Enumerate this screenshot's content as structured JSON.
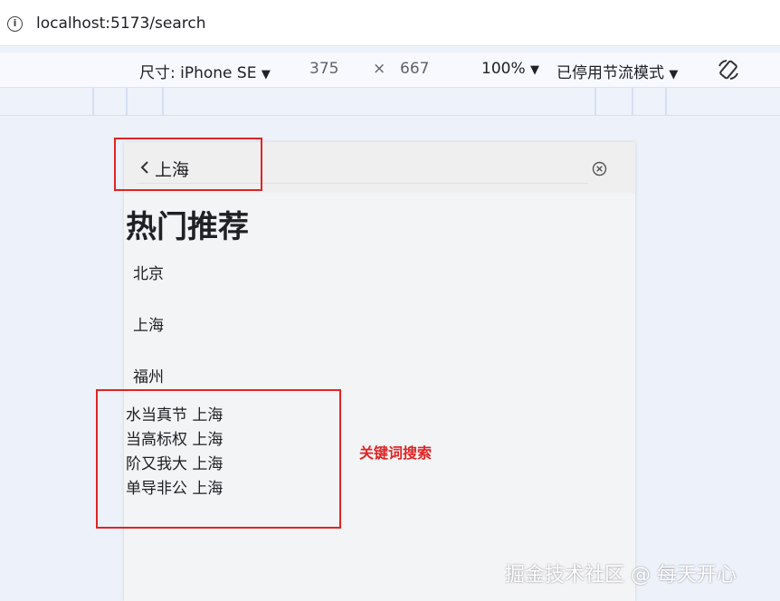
{
  "browser": {
    "url": "localhost:5173/search",
    "info_icon": "info-icon"
  },
  "devtools": {
    "device_label": "尺寸: iPhone SE",
    "width": "375",
    "times": "×",
    "height": "667",
    "zoom": "100%",
    "throttle": "已停用节流模式",
    "rotate_icon": "rotate-icon"
  },
  "app": {
    "search_value": "上海",
    "hot_title": "热门推荐",
    "hot_cities": [
      "北京",
      "上海",
      "福州"
    ],
    "results": [
      "水当真节 上海",
      "当高标权 上海",
      "阶又我大 上海",
      "单导非公 上海"
    ]
  },
  "annotations": {
    "keyword_search": "关键词搜索",
    "accent_color": "#e02424"
  },
  "watermark": "掘金技术社区 @ 每天开心"
}
